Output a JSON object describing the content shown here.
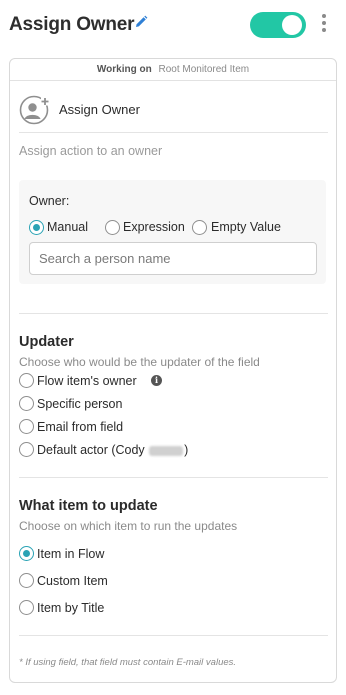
{
  "header": {
    "title": "Assign Owner",
    "toggle_on": true,
    "accent_color": "#22c7a5"
  },
  "working_on": {
    "label": "Working on",
    "value": "Root Monitored Item"
  },
  "action": {
    "icon": "add-user-icon",
    "label": "Assign Owner",
    "description": "Assign action to an owner"
  },
  "owner": {
    "label": "Owner:",
    "options": [
      {
        "label": "Manual",
        "checked": true
      },
      {
        "label": "Expression",
        "checked": false
      },
      {
        "label": "Empty Value",
        "checked": false
      }
    ],
    "search_placeholder": "Search a person name",
    "search_value": ""
  },
  "updater": {
    "title": "Updater",
    "subtitle": "Choose who would be the updater of the field",
    "options": [
      {
        "label": "Flow item's owner",
        "checked": false
      },
      {
        "label": "Specific person",
        "checked": false
      },
      {
        "label": "Email from field",
        "checked": false
      },
      {
        "label": "Default actor (Cody",
        "suffix": ")",
        "checked": false
      }
    ]
  },
  "target": {
    "title": "What item to update",
    "subtitle": "Choose on which item to run the updates",
    "options": [
      {
        "label": "Item in Flow",
        "checked": true
      },
      {
        "label": "Custom Item",
        "checked": false
      },
      {
        "label": "Item by Title",
        "checked": false
      }
    ]
  },
  "footnote": "* If using field, that field must contain E-mail values."
}
